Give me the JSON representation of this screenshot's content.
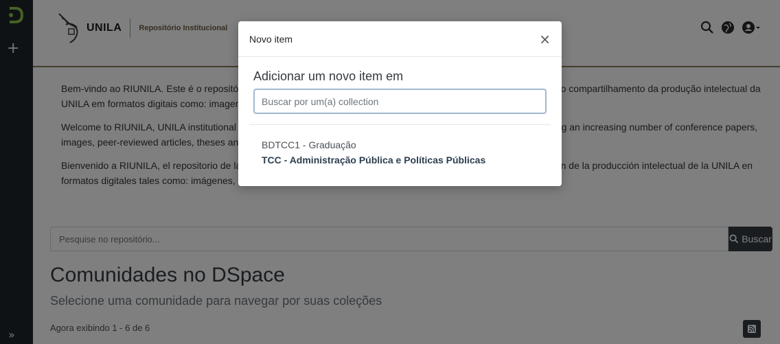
{
  "header": {
    "brand_name": "UNILA",
    "brand_sub": "Repositório Institucional"
  },
  "intro": {
    "pt": "Bem-vindo ao RIUNILA. Este é o repositório institucional da UNILA, que objetiva o armazenamento, a preservação e o compartilhamento da produção intelectual da UNILA em formatos digitais como: imagens, artigos, teses, dissertações, vídeos.",
    "en": "Welcome to RIUNILA, UNILA institutional repository, which aims to preserve and disseminate digital materials including an increasing number of conference papers, images, peer-reviewed articles, theses and working papers.",
    "es": "Bienvenido a RIUNILA, el repositorio de la UNILA, que tiene como objetivo el almacenamiento, preservación y difusión de la producción intelectual de la UNILA en formatos digitales tales como: imágenes, artículos, tesis, disertaciones, videos."
  },
  "search": {
    "placeholder": "Pesquise no repositório...",
    "button_label": "Buscar"
  },
  "communities": {
    "title": "Comunidades no DSpace",
    "subtitle": "Selecione uma comunidade para navegar por suas coleções",
    "showing": "Agora exibindo 1 - 6 de 6"
  },
  "modal": {
    "title": "Novo item",
    "close": "×",
    "heading": "Adicionar um novo item em",
    "search_placeholder": "Buscar por um(a) collection",
    "result_parent": "BDTCC1 - Graduação",
    "result_item": "TCC - Administração Pública e Políticas Públicas"
  },
  "icons": {
    "sidebar_logo": "dspace-logo-icon",
    "sidebar_add": "plus-icon",
    "sidebar_expand": "double-chevron-right-icon",
    "header_search": "search-icon",
    "header_language": "globe-icon",
    "header_user": "user-icon"
  },
  "colors": {
    "sidebar_bg": "#1f2428",
    "header_border": "#8a7a5c",
    "button_dark": "#343a40"
  }
}
